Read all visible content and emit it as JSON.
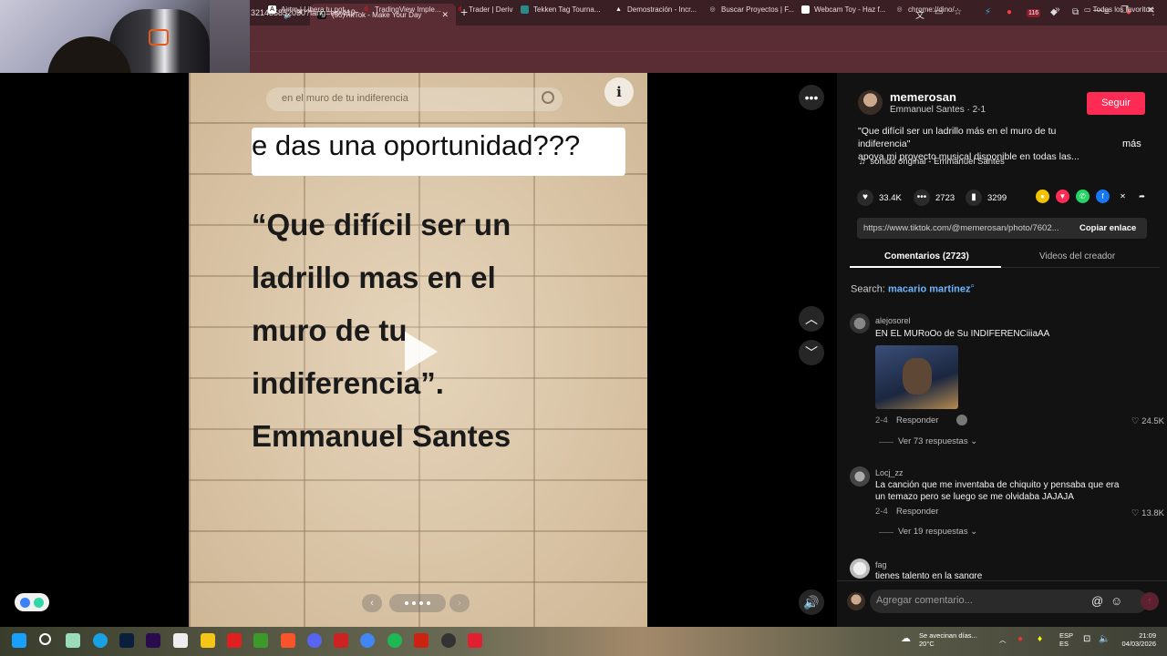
{
  "browser": {
    "tab_title": "(55)TikTok - Make Your Day",
    "url": "3214358520​50?lang=es-419",
    "new_tab": "+",
    "ext_badge": "116",
    "bookmarks": [
      {
        "label": "Airtm | Libera tu pot...",
        "icon_color": "#ffffff"
      },
      {
        "label": "TradingView Imple...",
        "icon_color": "#e02020"
      },
      {
        "label": "Trader | Deriv",
        "icon_color": "#e02020"
      },
      {
        "label": "Tekken Tag Tourna...",
        "icon_color": "#2a8a8a"
      },
      {
        "label": "Demostración - Incr...",
        "icon_color": "#ffffff"
      },
      {
        "label": "Buscar Proyectos | F...",
        "icon_color": "#cccccc"
      },
      {
        "label": "Webcam Toy - Haz f...",
        "icon_color": "#ffffff"
      },
      {
        "label": "chrome://dino/",
        "icon_color": "#cccccc"
      }
    ],
    "bookmarks_all": "Todos los favoritos"
  },
  "post": {
    "search_text": "en el muro de tu indiferencia",
    "info_glyph": "i",
    "banner_text": "e das una oportunidad???",
    "quote_lines": [
      "“Que difícil ser un",
      "ladrillo mas en el",
      "muro de tu",
      "indiferencia”.",
      "Emmanuel Santes"
    ]
  },
  "panel": {
    "username": "memerosan",
    "subline": "Emmanuel Santes · 2-1",
    "follow_label": "Seguir",
    "description_line1": "\"Que difícil ser un ladrillo más en el muro de tu indiferencia\"",
    "description_line2": "apoya mi proyecto musical disponible en todas las...",
    "more_label": "más",
    "sound": "sonido original - Emmanuel Santes",
    "likes": "33.4K",
    "comments_count": "2723",
    "saves": "3299",
    "link_url": "https://www.tiktok.com/@memerosan/photo/7602...",
    "copy_link": "Copiar enlace",
    "tab_comments": "Comentarios (2723)",
    "tab_creator": "Videos del creador",
    "search_prefix": "Search:",
    "search_term": "macario martínez",
    "input_placeholder": "Agregar comentario...",
    "comments": [
      {
        "user": "alejosorel",
        "text": "EN EL MURoOo de Su INDIFERENCiiiaAA",
        "date": "2-4",
        "reply": "Responder",
        "likes": "24.5K",
        "views": "Ver 73 respuestas"
      },
      {
        "user": "Locj_zz",
        "text": "La canción que me inventaba de chiquito y pensaba que era un temazo pero se luego se me olvidaba JAJAJA",
        "date": "2-4",
        "reply": "Responder",
        "likes": "13.8K",
        "views": "Ver 19 respuestas"
      },
      {
        "user": "fag",
        "text": "tienes talento en la sangre"
      }
    ]
  },
  "taskbar": {
    "weather_line1": "Se avecinan días...",
    "weather_line2": "20°C",
    "lang1": "ESP",
    "lang2": "ES",
    "time": "21:09",
    "date": "04/03/2026"
  }
}
